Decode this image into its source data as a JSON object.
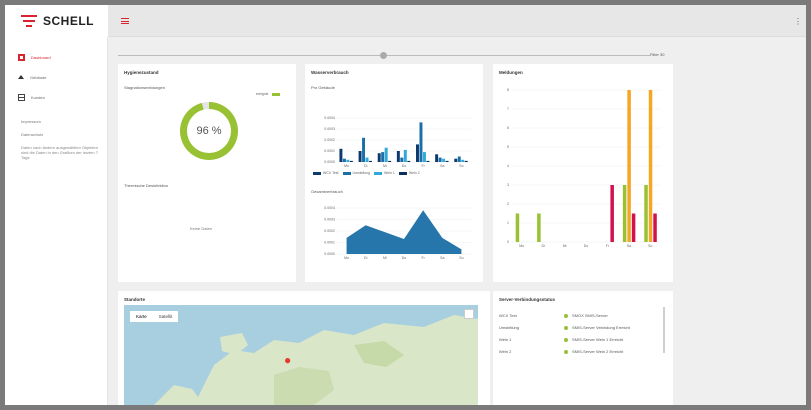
{
  "brand": {
    "name": "SCHELL",
    "accent": "#d9232e"
  },
  "topbar": {
    "menu_icon": "hamburger-icon",
    "more_icon": "⋮"
  },
  "sidebar": {
    "items": [
      {
        "label": "Dashboard",
        "icon": "dashboard-icon",
        "active": true
      },
      {
        "label": "Gebäude",
        "icon": "home-icon",
        "active": false
      },
      {
        "label": "Kunden",
        "icon": "table-icon",
        "active": false
      }
    ],
    "links": [
      "Impressum",
      "Datenschutz"
    ],
    "note": "Daten nach ändern ausgewählten Objekten sind die Daten in den Grafiken der letzten 7 Tage"
  },
  "slider": {
    "label": "Filter 30"
  },
  "hygiene": {
    "title": "Hygienezustand",
    "sub1": "Stagnationsmeldungen",
    "legend": "ereignis",
    "value": "96 %",
    "percent": 96,
    "sub2": "Thermische Desinfektion",
    "empty": "Keine Daten"
  },
  "water": {
    "title": "Wasserverbrauch",
    "sub1": "Pro Gebäude",
    "sub2": "Gesamtverbrauch",
    "legend": [
      {
        "label": "WCX Test",
        "color": "#0c3a6e"
      },
      {
        "label": "Umstellung",
        "color": "#1a6fa8"
      },
      {
        "label": "Weln 1",
        "color": "#2ea9da"
      },
      {
        "label": "Weln 2",
        "color": "#0b2f5c"
      }
    ]
  },
  "messages": {
    "title": "Meldungen"
  },
  "location": {
    "title": "Standorte",
    "tabs": [
      "Karte",
      "Satellit"
    ]
  },
  "server": {
    "title": "Server-Verbindungsstatus",
    "rows": [
      {
        "name": "WCX Test",
        "status": "SMOX SMIS-Server"
      },
      {
        "name": "Umstellung",
        "status": "SMIS-Server Vebindung Erreicht"
      },
      {
        "name": "Weln 1",
        "status": "SMIS-Server Weln 1 Erreicht"
      },
      {
        "name": "Weln 2",
        "status": "SMIS-Server Weln 2 Erreicht"
      }
    ]
  },
  "chart_data": [
    {
      "type": "bar",
      "title": "Pro Gebäude",
      "categories": [
        "Mo",
        "Di",
        "Mi",
        "Do",
        "Fr",
        "Sa",
        "So"
      ],
      "series": [
        {
          "name": "WCX Test",
          "values": [
            0.0012,
            0.001,
            0.0008,
            0.001,
            0.0016,
            0.0007,
            0.0003
          ]
        },
        {
          "name": "Umstellung",
          "values": [
            0.0003,
            0.0022,
            0.0009,
            0.0004,
            0.0036,
            0.0004,
            0.0005
          ]
        },
        {
          "name": "Weln 1",
          "values": [
            0.0002,
            0.0004,
            0.0013,
            0.0011,
            0.0009,
            0.0003,
            0.0002
          ]
        },
        {
          "name": "Weln 2",
          "values": [
            0.0001,
            0.0001,
            0.0001,
            0.0001,
            0.0001,
            0.0001,
            0.0001
          ]
        }
      ],
      "yticks": [
        "0.0004",
        "0.0003",
        "0.0002",
        "0.0001",
        "0.0000"
      ],
      "ylim": [
        0,
        0.004
      ]
    },
    {
      "type": "area",
      "title": "Gesamtverbrauch",
      "categories": [
        "Mo",
        "Di",
        "Mi",
        "Do",
        "Fr",
        "Sa",
        "So"
      ],
      "values": [
        0.0014,
        0.0025,
        0.0019,
        0.0013,
        0.0038,
        0.0014,
        0.0004
      ],
      "yticks": [
        "0.0004",
        "0.0003",
        "0.0002",
        "0.0001",
        "0.0000"
      ],
      "ylim": [
        0,
        0.004
      ],
      "color": "#1a6fa8"
    },
    {
      "type": "bar",
      "title": "Meldungen",
      "categories": [
        "Mo",
        "Di",
        "Mi",
        "Do",
        "Fr",
        "Sa",
        "So"
      ],
      "yticks": [
        "8",
        "7",
        "6",
        "5",
        "4",
        "3",
        "2",
        "1",
        "0"
      ],
      "ylim": [
        0,
        8
      ],
      "series": [
        {
          "color": "#99c134",
          "values": [
            1.5,
            1.5,
            0,
            0,
            0,
            3,
            3
          ]
        },
        {
          "color": "#f5a623",
          "values": [
            0,
            0,
            0,
            0,
            0,
            8,
            8
          ]
        },
        {
          "color": "#d0134f",
          "values": [
            0,
            0,
            0,
            0,
            3,
            1.5,
            1.5
          ]
        }
      ]
    }
  ]
}
